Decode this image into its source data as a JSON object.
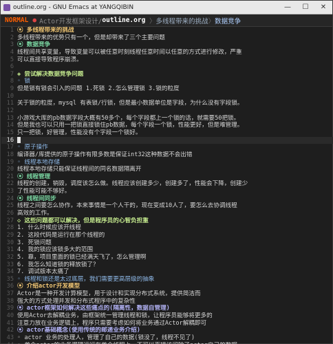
{
  "window": {
    "title": "outline.org - GNU Emacs at YANGQIBIN",
    "minimize": "—",
    "maximize": "☐",
    "close": "✕"
  },
  "modeline": {
    "mode": "NORMAL",
    "path": "Actor开发框架设计/",
    "file": "outline.org",
    "crumbs": [
      "多线程带来的挑战",
      "数据竞争"
    ]
  },
  "lines": [
    {
      "n": "1",
      "cls": "h1",
      "text": "  ⦿ 多线程带来的挑战"
    },
    {
      "n": "2",
      "cls": "",
      "text": "  多线程带来的优势只有一个，但是却带来了三个主要问题"
    },
    {
      "n": "3",
      "cls": "h2",
      "text": "  ⦿ 数据竞争"
    },
    {
      "n": "4",
      "cls": "",
      "text": "线程间共享变量，导致变量可以被任意时刻线程任意时间以任意的方式进行修改，严重"
    },
    {
      "n": "5",
      "cls": "",
      "text": "可以直接导致程序崩溃。"
    },
    {
      "n": "6",
      "cls": "",
      "text": ""
    },
    {
      "n": "7",
      "cls": "h3",
      "text": "  ◈ 尝试解决数据竞争问题"
    },
    {
      "n": "8",
      "cls": "bullet",
      "text": "  ◦ 锁"
    },
    {
      "n": "9",
      "cls": "",
      "text": "    但是锁有锁会引入的问题 1.死锁 2.怎么管理锁 3.锁的粒度"
    },
    {
      "n": "10",
      "cls": "",
      "text": ""
    },
    {
      "n": "11",
      "cls": "",
      "text": "    关于锁的粒度，mysql 有表锁/行锁，但是最小数据单位是字段，为什么没有字段锁。"
    },
    {
      "n": "12",
      "cls": "",
      "text": ""
    },
    {
      "n": "13",
      "cls": "",
      "text": "    小游戏大库的pb数据字段大概有50多个，每个字段都上一个锁的话，就需要50把锁。"
    },
    {
      "n": "14",
      "cls": "",
      "text": "    但是我也可以只用一把锁直接锁住pb数据，每个字段一个锁，性能更好，但是难管理。"
    },
    {
      "n": "15",
      "cls": "",
      "text": "    只一把锁，好管理，性能没有个字段一个锁好。"
    },
    {
      "n": "16",
      "cls": "current",
      "text": "  "
    },
    {
      "n": "17",
      "cls": "bullet",
      "text": "  ◦ 原子操作"
    },
    {
      "n": "18",
      "cls": "",
      "text": "    编译器/库提供的原子操作有限多数是保证int32这种数据不会出错"
    },
    {
      "n": "19",
      "cls": "bullet",
      "text": "  ◦ 线程本地存储"
    },
    {
      "n": "20",
      "cls": "",
      "text": "    线程本地存储只能保证线程间的同名数据隔离开"
    },
    {
      "n": "21",
      "cls": "h2",
      "text": "  ⦿ 线程管理"
    },
    {
      "n": "22",
      "cls": "",
      "text": "线程的创建，销毁，调度该怎么做。线程应该创建多少，创建多了，性能会下降，创建少"
    },
    {
      "n": "23",
      "cls": "",
      "text": "了性能可能不够好。"
    },
    {
      "n": "24",
      "cls": "h2",
      "text": "  ⦿ 线程间同步"
    },
    {
      "n": "25",
      "cls": "",
      "text": "线程之间要怎么协作，本来事情是一个人干的，现在变成10人了，要怎么去协调线程"
    },
    {
      "n": "26",
      "cls": "",
      "text": "高效的工作。"
    },
    {
      "n": "27",
      "cls": "h3",
      "text": "  ◇ 这些问题都可以解决，但是程序员的心智负担重"
    },
    {
      "n": "28",
      "cls": "",
      "text": "    1. 什么时候应该开线程"
    },
    {
      "n": "29",
      "cls": "",
      "text": "    2. 这段代码是运行在那个线程的"
    },
    {
      "n": "30",
      "cls": "",
      "text": "    3. 死锁问题"
    },
    {
      "n": "31",
      "cls": "",
      "text": "    4. 我的锁应该锁多大的范围"
    },
    {
      "n": "32",
      "cls": "",
      "text": "    5. 靠，项目里面的锁已经满天飞了，怎么管理啊"
    },
    {
      "n": "33",
      "cls": "",
      "text": "    6. 我怎么知道锁的释放锁了？"
    },
    {
      "n": "34",
      "cls": "",
      "text": "    7. 调试版本太痛了"
    },
    {
      "n": "35",
      "cls": "bullet",
      "text": "  ◦ 线程和锁还是太过底层，我们需要更高层级的抽象"
    },
    {
      "n": "36",
      "cls": "h1",
      "text": "  ⦿ 介绍actor开发模型"
    },
    {
      "n": "37",
      "cls": "",
      "text": "Actor是一种开发计算模型，用于设计和实现分布式系统，提供简洁而"
    },
    {
      "n": "38",
      "cls": "",
      "text": "强大的方式处理并发和分布式程序中的复杂性"
    },
    {
      "n": "39",
      "cls": "h4",
      "text": "  ⦿ actor框架如何解决这些痛点的(隔离性，数据自管理)"
    },
    {
      "n": "40",
      "cls": "",
      "text": "使用Actor去解耦业务，由框架统一管理线程和锁，让程序员能够将更多的"
    },
    {
      "n": "41",
      "cls": "",
      "text": "注意力放在业务逻辑上，程序只需要考虑如何将业务通过Actor解耦即可"
    },
    {
      "n": "42",
      "cls": "h4",
      "text": "  ⦿ actor基础概念(使用传统的邮递业务介绍)"
    },
    {
      "n": "43",
      "cls": "",
      "text": "  ◦ actor 业务的处理人，管理了自己的数据(锁没了，线程不见了)"
    },
    {
      "n": "44",
      "cls": "",
      "text": "    ◦ 单个actor的业务逻辑运行在单个线程上，不可以直接访问除了actor自己的数据"
    }
  ]
}
